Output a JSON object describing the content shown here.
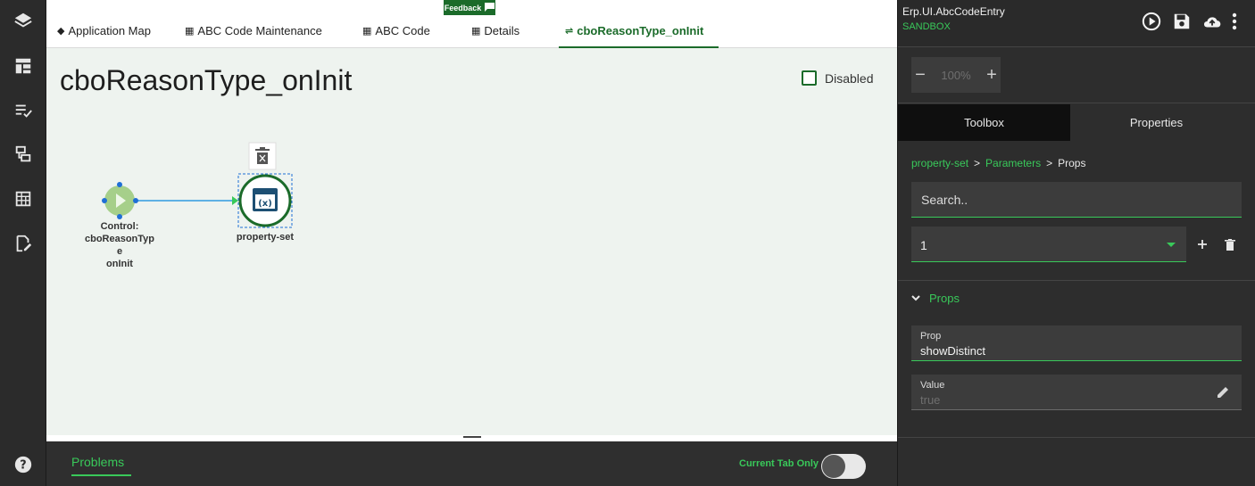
{
  "feedback": {
    "label": "Feedback"
  },
  "tabs": [
    {
      "label": "Application Map",
      "icon": "layers-icon"
    },
    {
      "label": "ABC Code Maintenance",
      "icon": "grid-icon"
    },
    {
      "label": "ABC Code",
      "icon": "grid-icon"
    },
    {
      "label": "Details",
      "icon": "grid-icon"
    },
    {
      "label": "cboReasonType_onInit",
      "icon": "flow-icon"
    }
  ],
  "canvas": {
    "title": "cboReasonType_onInit",
    "disabled_label": "Disabled",
    "start_node": {
      "lines": [
        "Control:",
        "cboReasonTyp",
        "e",
        "onInit"
      ]
    },
    "action_node": {
      "label": "property-set",
      "glyph": "(x)"
    }
  },
  "bottom": {
    "problems_label": "Problems",
    "current_tab_only_label": "Current Tab Only"
  },
  "right_panel": {
    "app_name": "Erp.UI.AbcCodeEntry",
    "environment": "SANDBOX",
    "zoom": {
      "value": "100%",
      "minus": "−",
      "plus": "+"
    },
    "tabs": [
      {
        "label": "Toolbox",
        "active": true
      },
      {
        "label": "Properties",
        "active": false
      }
    ],
    "breadcrumb": [
      {
        "label": "property-set",
        "link": true
      },
      {
        "label": ">",
        "link": false
      },
      {
        "label": "Parameters",
        "link": true
      },
      {
        "label": ">",
        "link": false
      },
      {
        "label": "Props",
        "link": false
      }
    ],
    "search_placeholder": "Search..",
    "selected_index": "1",
    "section_title": "Props",
    "prop_field": {
      "label": "Prop",
      "value": "showDistinct"
    },
    "value_field": {
      "label": "Value",
      "value": "true"
    }
  },
  "colors": {
    "accent": "#39c95a",
    "brand": "#1b6b2a",
    "canvas_bg": "#eef3ef",
    "panel_bg": "#2d2d2d"
  }
}
